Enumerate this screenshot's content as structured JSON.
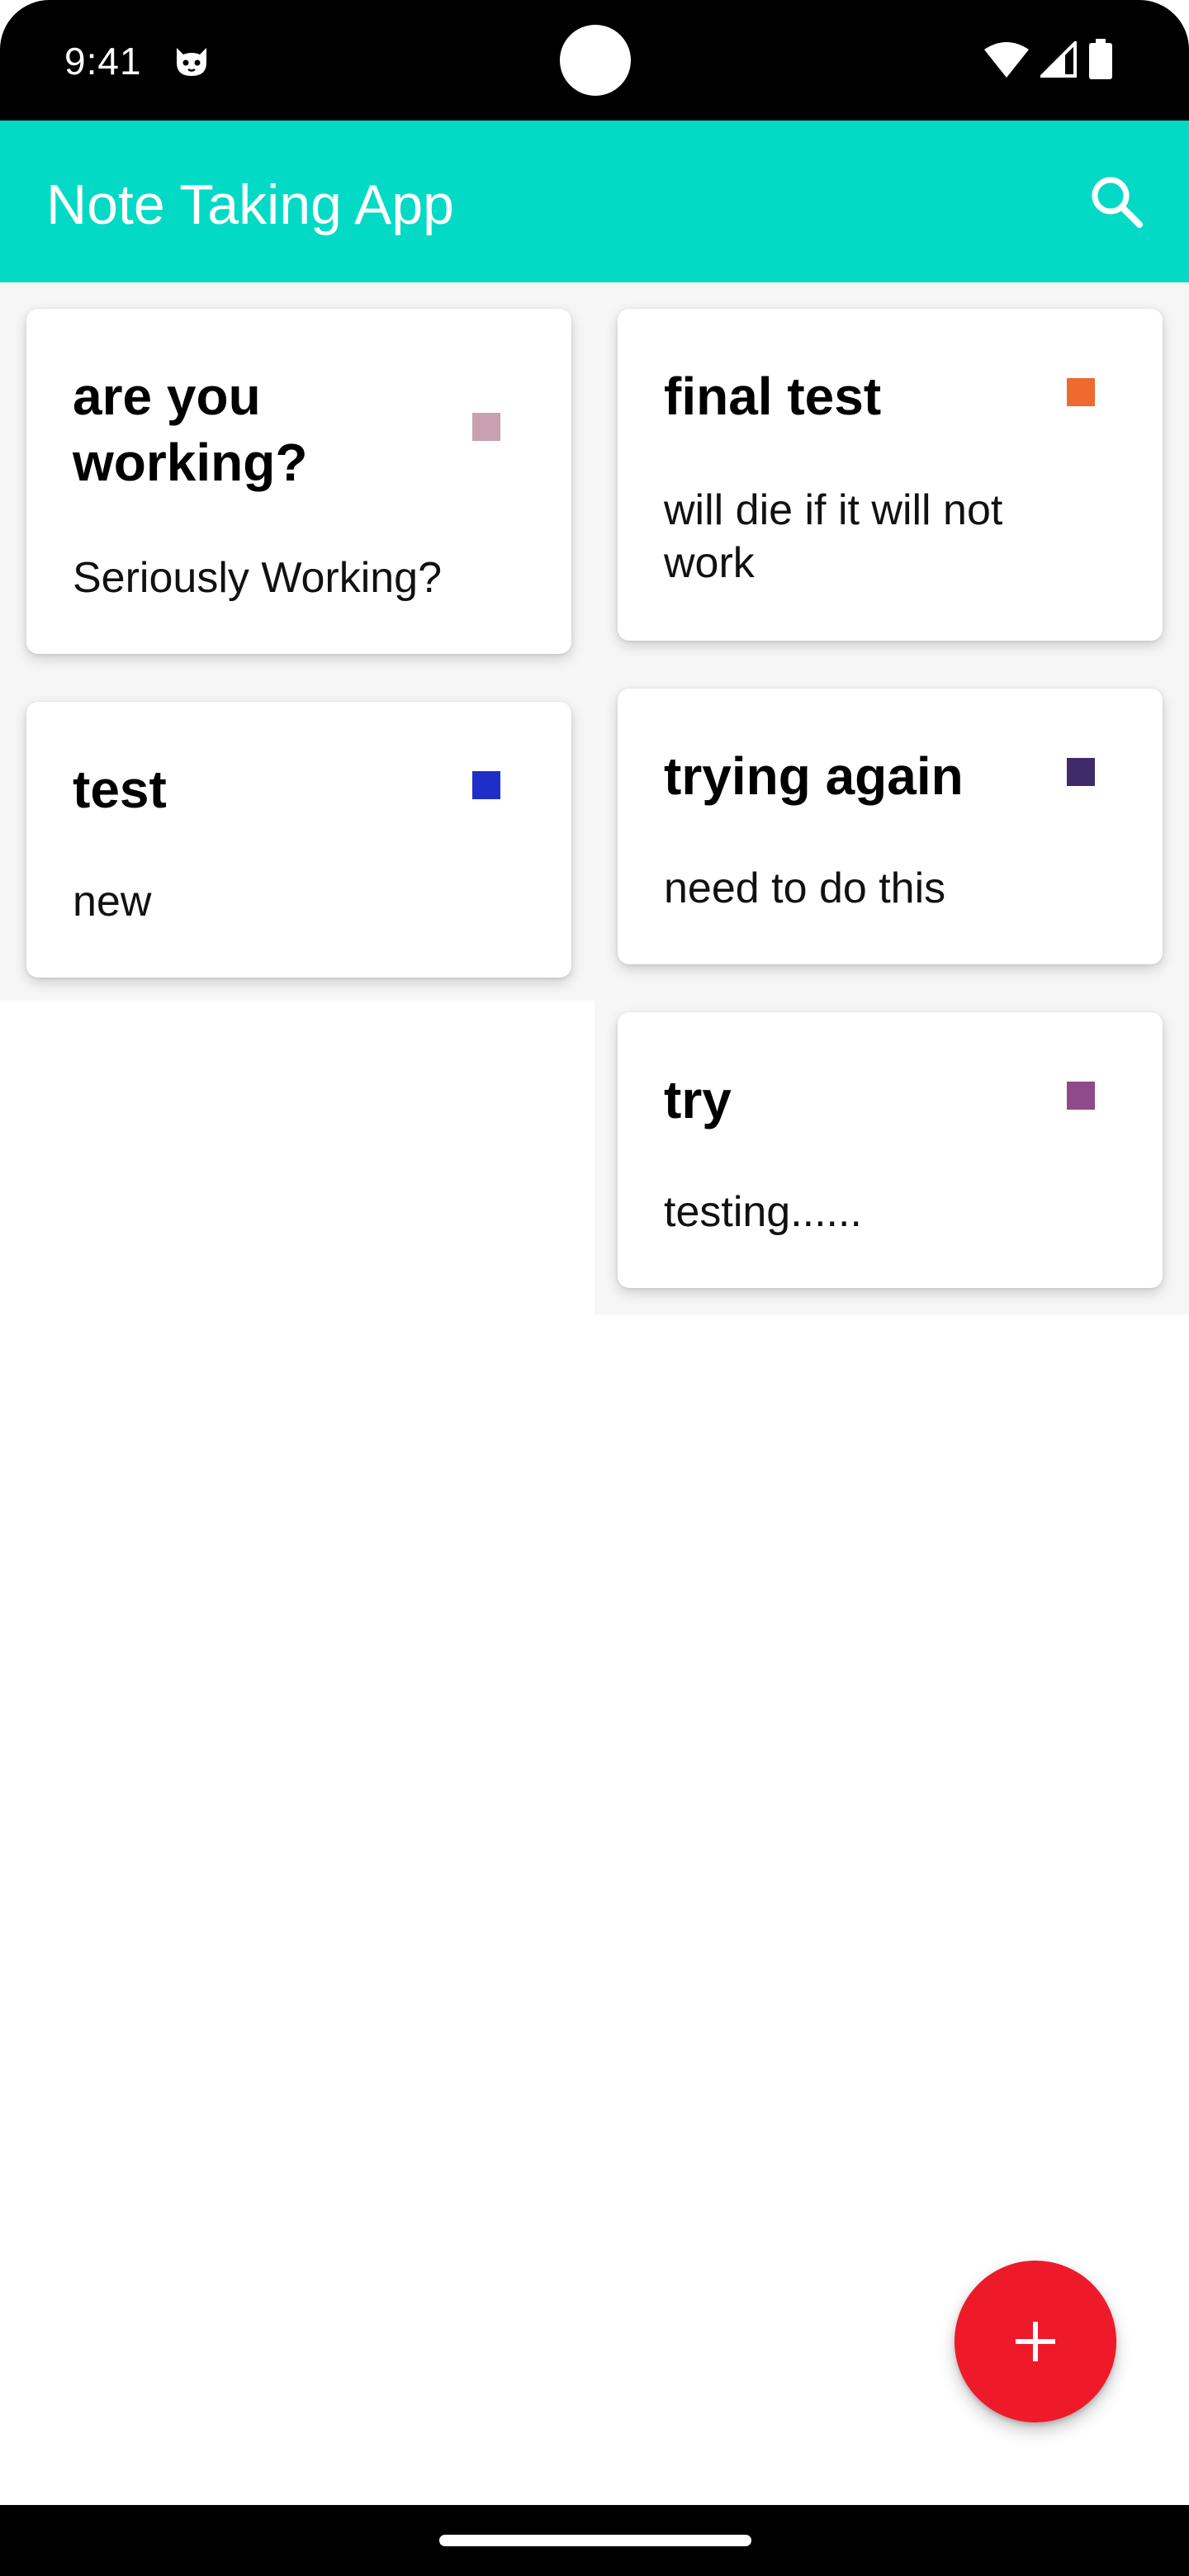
{
  "status_bar": {
    "time": "9:41",
    "icons": [
      "cat-notification-icon",
      "wifi-icon",
      "cellular-signal-icon",
      "battery-icon"
    ]
  },
  "app_bar": {
    "title": "Note Taking App",
    "search_icon": "search-icon",
    "background_color": "#03dac5"
  },
  "notes": {
    "left_column": [
      {
        "title": "are you working?",
        "body": "Seriously Working?",
        "color": "#c9a0b0"
      },
      {
        "title": "test",
        "body": "new",
        "color": "#1f2ec8"
      }
    ],
    "right_column": [
      {
        "title": "final test",
        "body": "will die if it will not work",
        "color": "#ee6a2e"
      },
      {
        "title": "trying again",
        "body": "need to do this",
        "color": "#3f2a6a"
      },
      {
        "title": "try",
        "body": "testing......",
        "color": "#8e4a8a"
      }
    ]
  },
  "fab": {
    "icon": "plus-icon",
    "color": "#ee1a2a"
  }
}
